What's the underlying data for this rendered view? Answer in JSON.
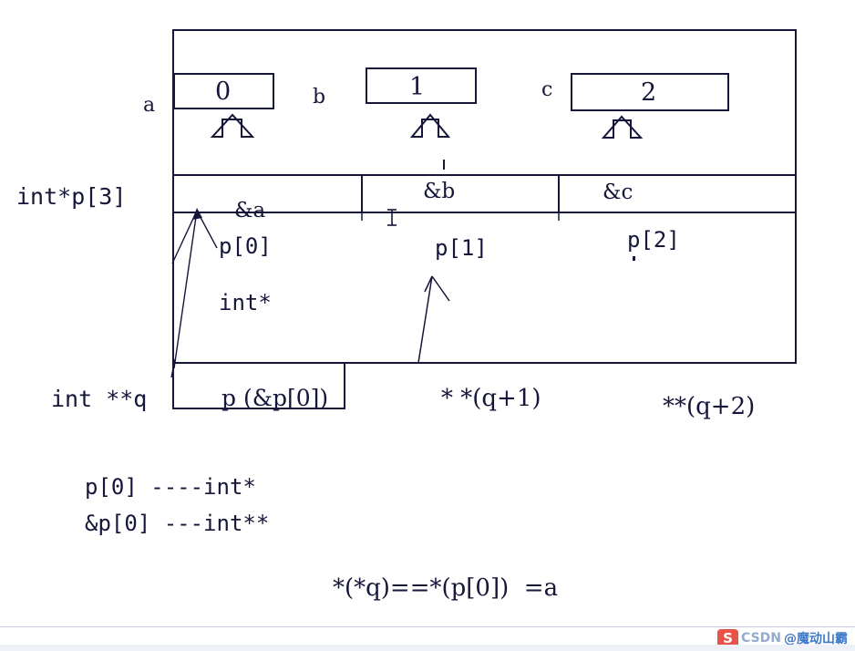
{
  "diagram": {
    "title": "int*p[3] pointer array diagram",
    "frame": {
      "label": "outer-frame"
    },
    "variables": [
      {
        "name": "a",
        "value": "0"
      },
      {
        "name": "b",
        "value": "1"
      },
      {
        "name": "c",
        "value": "2"
      }
    ],
    "array_cells": [
      {
        "address": "&a",
        "index_label": "p[0]"
      },
      {
        "address": "&b",
        "index_label": "p[1]"
      },
      {
        "address": "&c",
        "index_label": "p[2]"
      }
    ],
    "array_decl": "int*p[3]",
    "element_type": "int*",
    "q_decl": "int **q",
    "q_box_text": "p (&p[0])",
    "deref_expressions": [
      "* *(q+1)",
      "**(q+2)"
    ],
    "type_notes": [
      "p[0] ----int*",
      "&p[0] ---int**"
    ],
    "equation": "*(*q)==*(p[0])  =a",
    "cursor": {
      "name": "text-cursor-ibeam"
    }
  },
  "watermark": {
    "logo_letter": "S",
    "brand": "CSDN",
    "author": "@魔动山霸"
  },
  "colors": {
    "stroke": "#15163a",
    "text": "#15163a",
    "background": "#ffffff",
    "watermark_brand": "#2f6fc4",
    "watermark_logo": "#e8443a"
  }
}
